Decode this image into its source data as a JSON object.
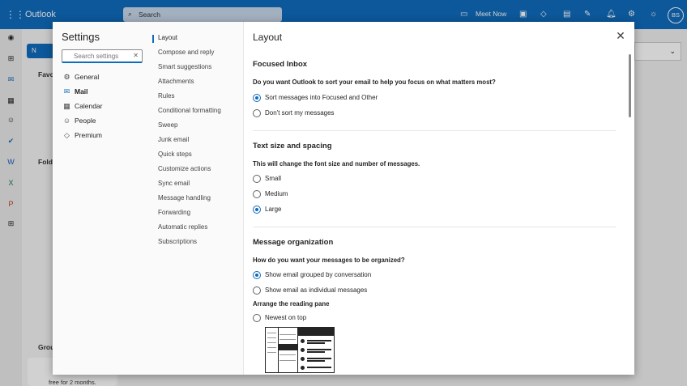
{
  "app": {
    "brand": "Outlook",
    "search_placeholder": "Search",
    "meet_now": "Meet Now",
    "avatar_initials": "BS"
  },
  "background": {
    "new_mail_label": "N",
    "favorites_label": "Favo",
    "folders_label": "Folde",
    "groups_label": "Grou",
    "promo_text": "free for 2 months."
  },
  "settings": {
    "title": "Settings",
    "search_placeholder": "Search settings",
    "categories": [
      {
        "label": "General",
        "icon": "gear-icon"
      },
      {
        "label": "Mail",
        "icon": "mail-icon"
      },
      {
        "label": "Calendar",
        "icon": "calendar-icon"
      },
      {
        "label": "People",
        "icon": "people-icon"
      },
      {
        "label": "Premium",
        "icon": "diamond-icon"
      }
    ],
    "subcategories": [
      "Layout",
      "Compose and reply",
      "Smart suggestions",
      "Attachments",
      "Rules",
      "Conditional formatting",
      "Sweep",
      "Junk email",
      "Quick steps",
      "Customize actions",
      "Sync email",
      "Message handling",
      "Forwarding",
      "Automatic replies",
      "Subscriptions"
    ],
    "page_title": "Layout",
    "focused_inbox": {
      "heading": "Focused Inbox",
      "question": "Do you want Outlook to sort your email to help you focus on what matters most?",
      "options": [
        "Sort messages into Focused and Other",
        "Don't sort my messages"
      ],
      "selected": 0
    },
    "text_size": {
      "heading": "Text size and spacing",
      "question": "This will change the font size and number of messages.",
      "options": [
        "Small",
        "Medium",
        "Large"
      ],
      "selected": 2
    },
    "organization": {
      "heading": "Message organization",
      "question": "How do you want your messages to be organized?",
      "options": [
        "Show email grouped by conversation",
        "Show email as individual messages"
      ],
      "selected": 0
    },
    "reading_pane": {
      "heading": "Arrange the reading pane",
      "options": [
        "Newest on top"
      ],
      "selected": -1
    }
  }
}
